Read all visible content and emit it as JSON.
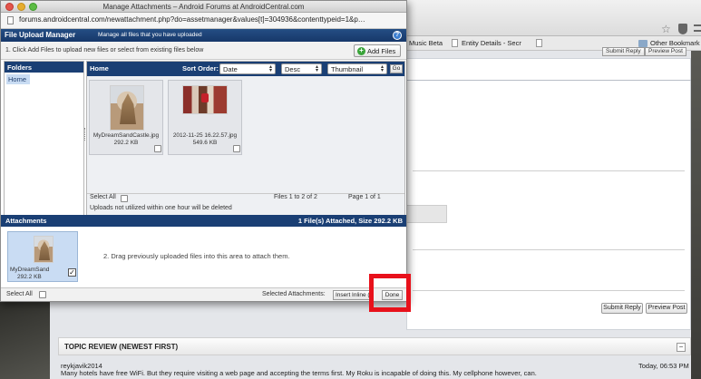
{
  "background_browser": {
    "bookmarks": [
      {
        "label": "Music Beta"
      },
      {
        "label": "Entity Details - Secr"
      },
      {
        "label": ""
      }
    ],
    "other_bookmarks": "Other Bookmark",
    "top_buttons": {
      "submit": "Submit Reply",
      "preview": "Preview Post"
    },
    "buttons": {
      "submit_reply": "Submit Reply",
      "preview_post": "Preview Post"
    },
    "topic_review": {
      "title": "TOPIC REVIEW (NEWEST FIRST)",
      "collapse": "−",
      "author": "reykjavik2014",
      "time": "Today, 06:53 PM",
      "text": "Many hotels have free WiFi. But they require visiting a web page and accepting the terms first. My Roku is incapable of doing this. My cellphone however, can."
    }
  },
  "popup": {
    "window_title": "Manage Attachments – Android Forums at AndroidCentral.com",
    "url": "forums.androidcentral.com/newattachment.php?do=assetmanager&values[t]=304936&contenttypeid=1&p…",
    "manager": {
      "title": "File Upload Manager",
      "subtitle": "Manage all files that you have uploaded",
      "help": "?"
    },
    "instructions": "1. Click Add Files to upload new files or select from existing files below",
    "add_files_label": "Add Files",
    "folders": {
      "title": "Folders",
      "items": [
        {
          "label": "Home"
        }
      ]
    },
    "files_panel": {
      "current_folder": "Home",
      "sort_order_label": "Sort Order:",
      "sort_field": "Date",
      "sort_dir": "Desc",
      "view_mode": "Thumbnail",
      "go_label": "Go",
      "files": [
        {
          "name": "MyDreamSandCastle.jpg",
          "size": "292.2 KB"
        },
        {
          "name": "2012-11-25 16.22.57.jpg",
          "size": "549.6 KB"
        }
      ],
      "select_all_label": "Select All",
      "files_count": "Files 1 to 2 of 2",
      "page_info": "Page 1 of 1",
      "note": "Uploads not utilized within one hour will be deleted"
    },
    "attachments": {
      "title": "Attachments",
      "summary": "1 File(s) Attached, Size 292.2 KB",
      "item": {
        "name": "MyDreamSand",
        "size": "292.2 KB",
        "checked_mark": "✓"
      },
      "drag_hint": "2. Drag previously uploaded files into this area to attach them."
    },
    "footer": {
      "select_all_label": "Select All",
      "selected_label": "Selected Attachments:",
      "insert_inline_label": "Insert Inline (1)",
      "done_label": "Done"
    }
  },
  "colors": {
    "header_blue": "#1a3f74",
    "selection_blue": "#c9dcf3",
    "highlight_red": "#e8111b"
  }
}
